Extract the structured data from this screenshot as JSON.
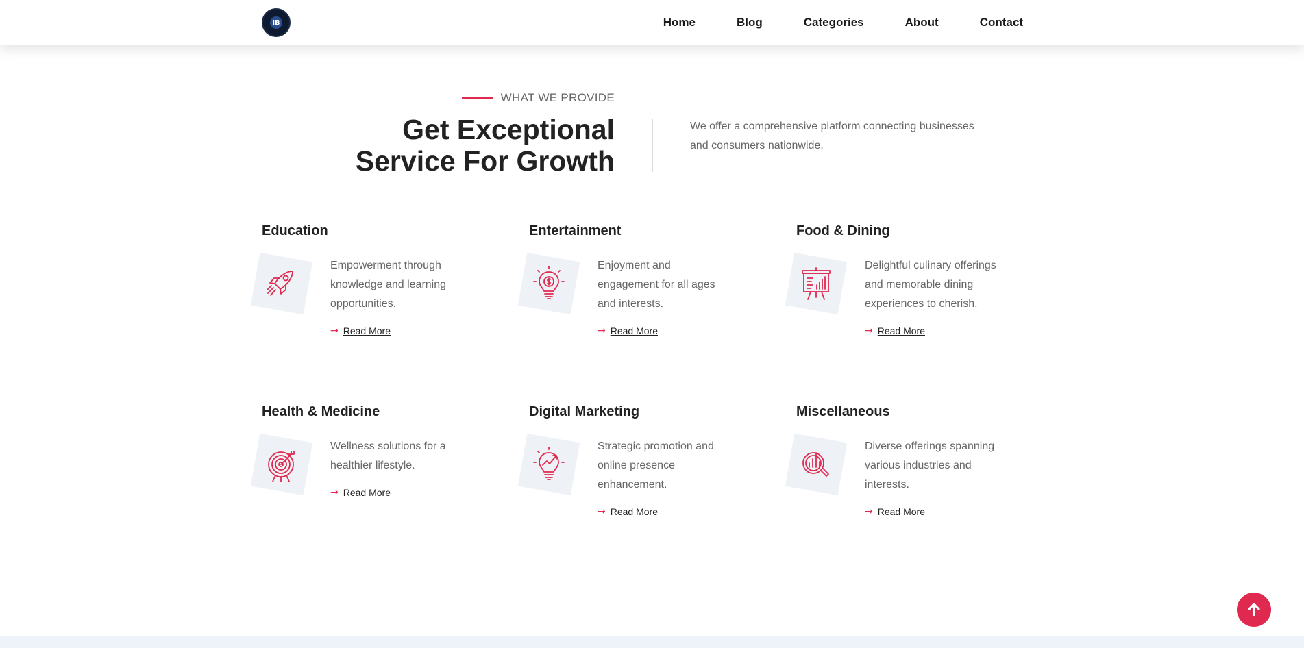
{
  "header": {
    "logo_text": "IB",
    "nav": [
      "Home",
      "Blog",
      "Categories",
      "About",
      "Contact"
    ]
  },
  "intro": {
    "eyebrow": "WHAT WE PROVIDE",
    "headline_line1": "Get Exceptional",
    "headline_line2": "Service For Growth",
    "description": "We offer a comprehensive platform connecting businesses and consumers nationwide."
  },
  "cards": [
    {
      "title": "Education",
      "description": "Empowerment through knowledge and learning opportunities.",
      "link": "Read More",
      "icon": "rocket-icon"
    },
    {
      "title": "Entertainment",
      "description": "Enjoyment and engagement for all ages and interests.",
      "link": "Read More",
      "icon": "lightbulb-dollar-icon"
    },
    {
      "title": "Food & Dining",
      "description": "Delightful culinary offerings and memorable dining experiences to cherish.",
      "link": "Read More",
      "icon": "presentation-board-icon"
    },
    {
      "title": "Health & Medicine",
      "description": "Wellness solutions for a healthier lifestyle.",
      "link": "Read More",
      "icon": "target-icon"
    },
    {
      "title": "Digital Marketing",
      "description": "Strategic promotion and online presence enhancement.",
      "link": "Read More",
      "icon": "lightbulb-growth-icon"
    },
    {
      "title": "Miscellaneous",
      "description": "Diverse offerings spanning various industries and interests.",
      "link": "Read More",
      "icon": "analytics-magnifier-icon"
    }
  ],
  "colors": {
    "accent": "#e0294f",
    "text": "#222222",
    "muted": "#666666",
    "icon_bg": "#eef1f6"
  },
  "scroll_top_icon": "arrow-up-icon"
}
